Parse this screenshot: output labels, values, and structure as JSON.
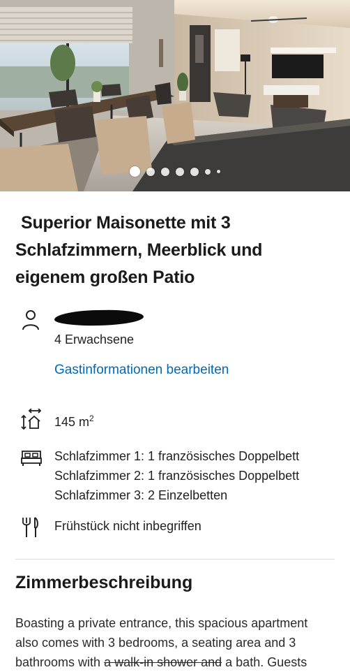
{
  "hero": {
    "image_alt": "Apartment living and dining area",
    "carousel": {
      "total_dots": 7,
      "active_index": 0
    }
  },
  "title": {
    "line1": "Superior Maisonette mit 3",
    "line2": "Schlafzimmern, Meerblick und",
    "line3": "eigenem großen Patio"
  },
  "guest": {
    "icon": "person-icon",
    "occupancy": "4 Erwachsene",
    "edit_link": "Gastinformationen bearbeiten"
  },
  "size": {
    "icon": "room-size-icon",
    "value": "145 m",
    "unit_exp": "2"
  },
  "beds": {
    "icon": "bed-icon",
    "lines": [
      "Schlafzimmer 1: 1 französisches Doppelbett",
      "Schlafzimmer 2: 1 französisches Doppelbett",
      "Schlafzimmer 3: 2 Einzelbetten"
    ]
  },
  "meals": {
    "icon": "cutlery-icon",
    "text": "Frühstück nicht inbegriffen"
  },
  "description": {
    "heading": "Zimmerbeschreibung",
    "line1": "Boasting a private entrance, this spacious apartment",
    "line2": "also comes with 3 bedrooms, a seating area and 3",
    "line3_a": "bathrooms with ",
    "line3_strike": "a walk-in shower and",
    "line3_b": " a bath. Guests"
  },
  "colors": {
    "link": "#0068b5",
    "text": "#1a1a1a",
    "divider": "#dcdcdc"
  }
}
